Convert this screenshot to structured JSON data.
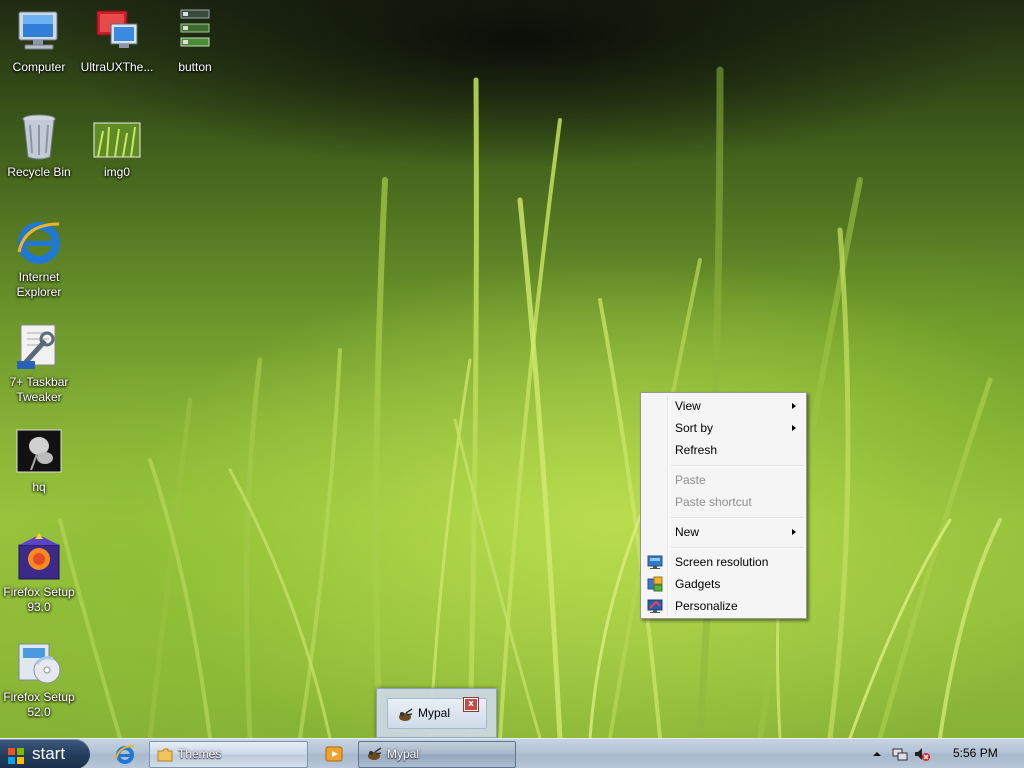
{
  "desktop_icons": [
    {
      "label": "Computer",
      "icon": "computer-icon"
    },
    {
      "label": "UltraUXThe...",
      "icon": "ultrauxtheme-icon"
    },
    {
      "label": "button",
      "icon": "button-file-icon"
    },
    {
      "label": "Recycle Bin",
      "icon": "recycle-bin-icon"
    },
    {
      "label": "img0",
      "icon": "image-thumbnail-icon"
    },
    {
      "label": "Internet Explorer",
      "icon": "internet-explorer-icon"
    },
    {
      "label": "7+ Taskbar Tweaker",
      "icon": "taskbar-tweaker-icon"
    },
    {
      "label": "hq",
      "icon": "image-thumbnail-icon"
    },
    {
      "label": "Firefox Setup 93.0",
      "icon": "installer-icon"
    },
    {
      "label": "Firefox Setup 52.0",
      "icon": "installer-disc-icon"
    }
  ],
  "context_menu": {
    "items": [
      {
        "label": "View",
        "submenu": true,
        "enabled": true
      },
      {
        "label": "Sort by",
        "submenu": true,
        "enabled": true
      },
      {
        "label": "Refresh",
        "submenu": false,
        "enabled": true
      },
      {
        "label": "Paste",
        "submenu": false,
        "enabled": false
      },
      {
        "label": "Paste shortcut",
        "submenu": false,
        "enabled": false
      },
      {
        "label": "New",
        "submenu": true,
        "enabled": true
      },
      {
        "label": "Screen resolution",
        "submenu": false,
        "enabled": true,
        "icon": "screen-resolution-icon"
      },
      {
        "label": "Gadgets",
        "submenu": false,
        "enabled": true,
        "icon": "gadgets-icon"
      },
      {
        "label": "Personalize",
        "submenu": false,
        "enabled": true,
        "icon": "personalize-icon"
      }
    ]
  },
  "taskbar": {
    "start_label": "start",
    "buttons": [
      {
        "label": "Themes",
        "icon": "folder-icon",
        "active": false
      },
      {
        "label": "Mypal",
        "icon": "mypal-icon",
        "active": true
      }
    ],
    "clock": "5:56 PM"
  },
  "preview": {
    "title": "Mypal",
    "close_label": "x"
  },
  "colors": {
    "taskbar": "#b4c4d6",
    "start_button": "#253d5e",
    "menu_background": "#f5f5f5",
    "disabled_text": "#8d8d8d"
  }
}
